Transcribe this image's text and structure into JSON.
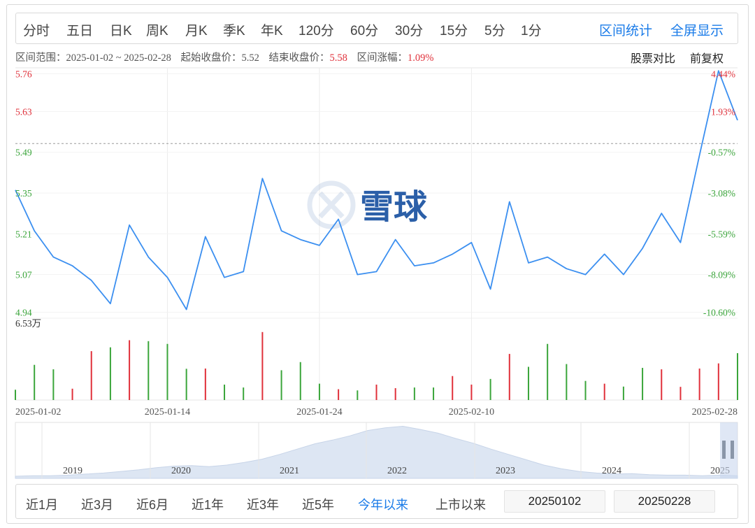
{
  "periods": [
    "分时",
    "五日",
    "日K",
    "周K",
    "月K",
    "季K",
    "年K",
    "120分",
    "60分",
    "30分",
    "15分",
    "5分",
    "1分"
  ],
  "actions": {
    "interval_stats": "区间统计",
    "fullscreen": "全屏显示"
  },
  "info": {
    "range_label": "区间范围：",
    "range_value": "2025-01-02 ~ 2025-02-28",
    "start_label": "起始收盘价：",
    "start_value": "5.52",
    "end_label": "结束收盘价：",
    "end_value": "5.58",
    "change_label": "区间涨幅：",
    "change_value": "1.09%"
  },
  "tools": {
    "compare": "股票对比",
    "adjust": "前复权"
  },
  "watermark": "雪球",
  "colors": {
    "line": "#3b8ff0",
    "up": "#e0303a",
    "down": "#3aa53a",
    "accent": "#1a7be8"
  },
  "chart_data": {
    "type": "line",
    "price_axis": {
      "ylim": [
        4.92,
        5.78
      ],
      "ticks": [
        "5.76",
        "5.63",
        "5.49",
        "5.35",
        "5.21",
        "5.07",
        "4.94"
      ]
    },
    "pct_axis": {
      "ticks": [
        "4.44%",
        "1.93%",
        "-0.57%",
        "-3.08%",
        "-5.59%",
        "-8.09%",
        "-10.60%"
      ]
    },
    "base_price": 5.52,
    "x_labels": [
      "2025-01-02",
      "2025-01-14",
      "2025-01-24",
      "2025-02-10",
      "2025-02-28"
    ],
    "x_label_index": [
      0,
      8,
      16,
      24,
      38
    ],
    "series": [
      {
        "values": [
          5.36,
          5.22,
          5.13,
          5.1,
          5.05,
          4.97,
          5.24,
          5.13,
          5.06,
          4.95,
          5.2,
          5.06,
          5.08,
          5.4,
          5.22,
          5.19,
          5.17,
          5.26,
          5.07,
          5.08,
          5.19,
          5.1,
          5.11,
          5.14,
          5.18,
          5.02,
          5.32,
          5.11,
          5.13,
          5.09,
          5.07,
          5.14,
          5.07,
          5.16,
          5.28,
          5.18,
          5.48,
          5.77,
          5.6
        ]
      }
    ],
    "volume": {
      "max_label": "6.53万",
      "values": [
        0.78,
        2.67,
        2.33,
        0.86,
        3.71,
        4.0,
        4.54,
        4.47,
        4.26,
        2.37,
        2.39,
        1.17,
        0.95,
        5.16,
        2.26,
        2.88,
        1.24,
        0.82,
        0.73,
        1.17,
        0.9,
        0.95,
        0.95,
        1.82,
        1.17,
        1.6,
        3.5,
        2.52,
        4.26,
        2.73,
        1.45,
        1.24,
        1.02,
        2.44,
        2.33,
        1.0,
        2.39,
        2.78,
        3.56
      ],
      "direction": [
        "down",
        "down",
        "down",
        "up",
        "up",
        "down",
        "up",
        "down",
        "down",
        "down",
        "up",
        "down",
        "down",
        "up",
        "down",
        "down",
        "down",
        "up",
        "down",
        "up",
        "up",
        "down",
        "down",
        "up",
        "up",
        "down",
        "up",
        "down",
        "down",
        "down",
        "down",
        "up",
        "down",
        "down",
        "up",
        "up",
        "up",
        "up",
        "down"
      ]
    },
    "navigator": {
      "years": [
        "2019",
        "2020",
        "2021",
        "2022",
        "2023",
        "2024",
        "2025"
      ],
      "profile": [
        0.04,
        0.05,
        0.05,
        0.06,
        0.08,
        0.1,
        0.13,
        0.16,
        0.2,
        0.23,
        0.24,
        0.22,
        0.25,
        0.3,
        0.36,
        0.45,
        0.55,
        0.65,
        0.72,
        0.8,
        0.9,
        0.95,
        0.98,
        0.92,
        0.85,
        0.75,
        0.66,
        0.55,
        0.45,
        0.35,
        0.25,
        0.18,
        0.13,
        0.1,
        0.08,
        0.09,
        0.07,
        0.06,
        0.06,
        0.05,
        0.06,
        0.05
      ]
    }
  },
  "ranges": [
    "近1月",
    "近3月",
    "近6月",
    "近1年",
    "近3年",
    "近5年",
    "今年以来",
    "上市以来"
  ],
  "active_range": "今年以来",
  "start_date": "20250102",
  "end_date": "20250228"
}
